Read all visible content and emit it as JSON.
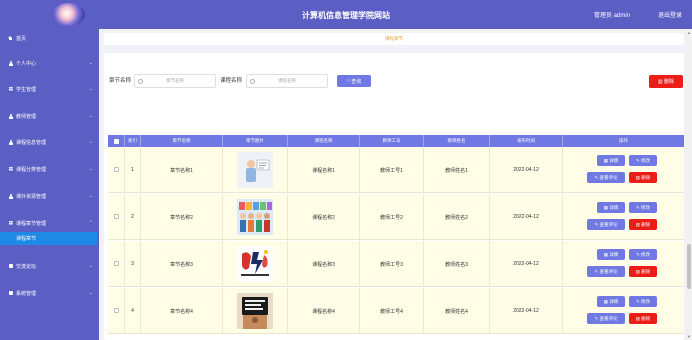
{
  "header": {
    "title": "计算机信息管理学院网站",
    "user_label": "管理员 admin",
    "logout_label": "退出登录"
  },
  "sidebar": {
    "items": [
      {
        "label": "首页",
        "icon": "home-icon"
      },
      {
        "label": "个人中心",
        "icon": "user-icon"
      },
      {
        "label": "学生管理",
        "icon": "grid-icon"
      },
      {
        "label": "教师管理",
        "icon": "user-icon"
      },
      {
        "label": "课程信息管理",
        "icon": "user-icon"
      },
      {
        "label": "课程分类管理",
        "icon": "grid-icon"
      },
      {
        "label": "课外资源管理",
        "icon": "user-icon"
      },
      {
        "label": "课程章节管理",
        "icon": "grid-icon"
      },
      {
        "label": "交流论坛",
        "icon": "square-icon"
      },
      {
        "label": "系统管理",
        "icon": "square-icon"
      }
    ],
    "active_sub": "课程章节",
    "chevron": "⌄"
  },
  "breadcrumb": "课程章节",
  "search": {
    "chapter_label": "章节名称",
    "chapter_placeholder": "章节名称",
    "course_label": "课程名称",
    "course_placeholder": "课程名称",
    "search_button": "查询",
    "delete_button": "删除"
  },
  "table": {
    "columns": [
      "",
      "索引",
      "章节名称",
      "章节图片",
      "课程名称",
      "教师工号",
      "教师姓名",
      "发布时间",
      "操作"
    ],
    "rows": [
      {
        "index": "1",
        "chapter": "章节名称1",
        "course": "课程名称1",
        "teacher_id": "教师工号1",
        "teacher_name": "教师姓名1",
        "date": "2022-04-12"
      },
      {
        "index": "2",
        "chapter": "章节名称2",
        "course": "课程名称2",
        "teacher_id": "教师工号2",
        "teacher_name": "教师姓名2",
        "date": "2022-04-12"
      },
      {
        "index": "3",
        "chapter": "章节名称3",
        "course": "课程名称3",
        "teacher_id": "教师工号3",
        "teacher_name": "教师姓名3",
        "date": "2022-04-12"
      },
      {
        "index": "4",
        "chapter": "章节名称4",
        "course": "课程名称4",
        "teacher_id": "教师工号4",
        "teacher_name": "教师姓名4",
        "date": "2022-04-12"
      }
    ],
    "actions": {
      "detail": "详情",
      "edit": "修改",
      "review": "查看评论",
      "delete": "删除"
    }
  },
  "colors": {
    "primary": "#5b5fc4",
    "button": "#6f78e3",
    "danger": "#ec1c17",
    "active_nav": "#1e8ae6",
    "row_bg": "#fffde6",
    "breadcrumb_text": "#e6a23c"
  }
}
